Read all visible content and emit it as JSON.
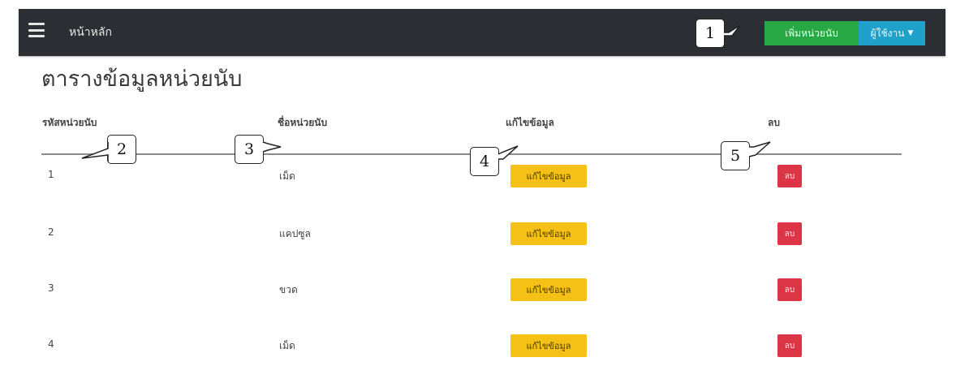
{
  "navbar": {
    "title": "หน้าหลัก",
    "add_unit_label": "เพิ่มหน่วยนับ",
    "user_menu_label": "ผู้ใช้งาน"
  },
  "page": {
    "title": "ตารางข้อมูลหน่วยนับ"
  },
  "table": {
    "columns": [
      "รหัสหน่วยนับ",
      "ชื่อหน่วยนับ",
      "แก้ไขข้อมูล",
      "ลบ"
    ],
    "edit_label": "แก้ไขข้อมูล",
    "delete_label": "ลบ",
    "rows": [
      {
        "id": "1",
        "name": "เม็ด"
      },
      {
        "id": "2",
        "name": "แคปซูล"
      },
      {
        "id": "3",
        "name": "ขวด"
      },
      {
        "id": "4",
        "name": "เม็ด"
      }
    ]
  },
  "callouts": [
    "1",
    "2",
    "3",
    "4",
    "5"
  ],
  "colors": {
    "navbar": "#2b2f33",
    "add_button": "#28a745",
    "user_button": "#1fa2c9",
    "edit_button": "#f5c117",
    "delete_button": "#dc3545"
  }
}
